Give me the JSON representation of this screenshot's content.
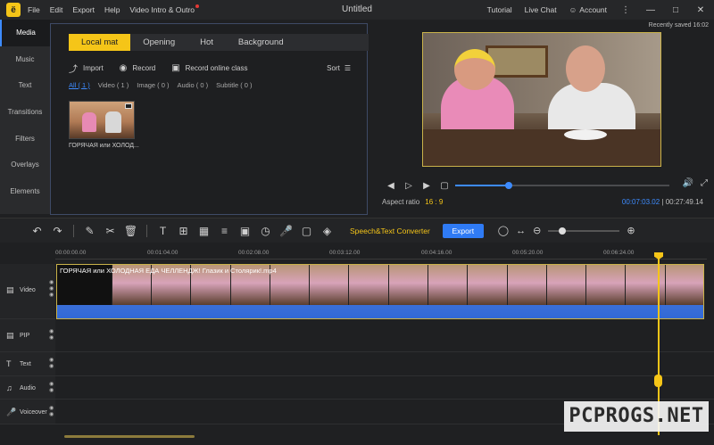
{
  "titlebar": {
    "logo_glyph": "ё",
    "menus": [
      "File",
      "Edit",
      "Export",
      "Help",
      "Video Intro & Outro"
    ],
    "title": "Untitled",
    "right": {
      "tutorial": "Tutorial",
      "live_chat": "Live Chat",
      "account": "Account"
    },
    "window_buttons": [
      "⋮",
      "—",
      "□",
      "✕"
    ]
  },
  "recently_saved": "Recently saved 16:02",
  "sidebar": {
    "items": [
      {
        "label": "Media",
        "active": true
      },
      {
        "label": "Music"
      },
      {
        "label": "Text"
      },
      {
        "label": "Transitions"
      },
      {
        "label": "Filters"
      },
      {
        "label": "Overlays"
      },
      {
        "label": "Elements"
      }
    ]
  },
  "media": {
    "tabs": [
      "Local mat",
      "Opening",
      "Hot",
      "Background"
    ],
    "actions": {
      "import": "Import",
      "record": "Record",
      "record_online": "Record online class",
      "sort": "Sort"
    },
    "filters": [
      "All ( 1 )",
      "Video ( 1 )",
      "Image ( 0 )",
      "Audio ( 0 )",
      "Subtitle ( 0 )"
    ],
    "items": [
      {
        "label": "ГОРЯЧАЯ или ХОЛОД..."
      }
    ]
  },
  "preview": {
    "progress": 0.25,
    "aspect_label": "Aspect ratio",
    "aspect_value": "16 : 9",
    "current_time": "00:07:03.02",
    "separator": "|",
    "total_time": "00:27:49.14"
  },
  "toolbar": {
    "speech_text": "Speech&Text Converter",
    "export_label": "Export",
    "zoom": 0.2
  },
  "ruler": {
    "ticks": [
      "00:00:00.00",
      "00:01:04.00",
      "00:02:08.00",
      "00:03:12.00",
      "00:04:16.00",
      "00:05:20.00",
      "00:06:24.00"
    ]
  },
  "tracks": [
    {
      "label": "Video"
    },
    {
      "label": "PIP"
    },
    {
      "label": "Text"
    },
    {
      "label": "Audio"
    },
    {
      "label": "Voiceover"
    }
  ],
  "clip": {
    "title": "ГОРЯЧАЯ или ХОЛОДНАЯ ЕДА ЧЕЛЛЕНДЖ! Глазик и Столярик!.mp4"
  },
  "watermark": "PCPROGS.NET"
}
